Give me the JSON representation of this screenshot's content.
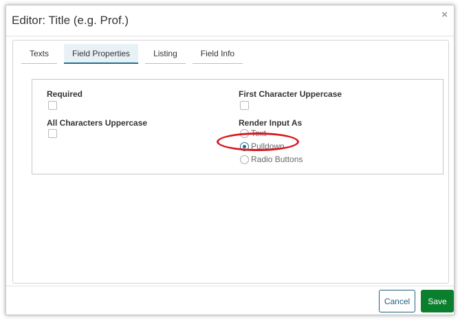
{
  "dialog": {
    "title": "Editor: Title (e.g. Prof.)",
    "close_glyph": "×"
  },
  "tabs": [
    {
      "label": "Texts",
      "active": false
    },
    {
      "label": "Field Properties",
      "active": true
    },
    {
      "label": "Listing",
      "active": false
    },
    {
      "label": "Field Info",
      "active": false
    }
  ],
  "fields": {
    "required": {
      "label": "Required",
      "checked": false
    },
    "first_char_uppercase": {
      "label": "First Character Uppercase",
      "checked": false
    },
    "all_chars_uppercase": {
      "label": "All Characters Uppercase",
      "checked": false
    },
    "render_input_as": {
      "label": "Render Input As",
      "options": [
        {
          "label": "Text",
          "selected": false
        },
        {
          "label": "Pulldown",
          "selected": true
        },
        {
          "label": "Radio Buttons",
          "selected": false
        }
      ]
    }
  },
  "annotation": {
    "color": "#d9161f",
    "target": "Pulldown"
  },
  "footer": {
    "cancel_label": "Cancel",
    "save_label": "Save"
  },
  "colors": {
    "accent": "#1d6f8f",
    "save_button": "#0b7f2e"
  }
}
